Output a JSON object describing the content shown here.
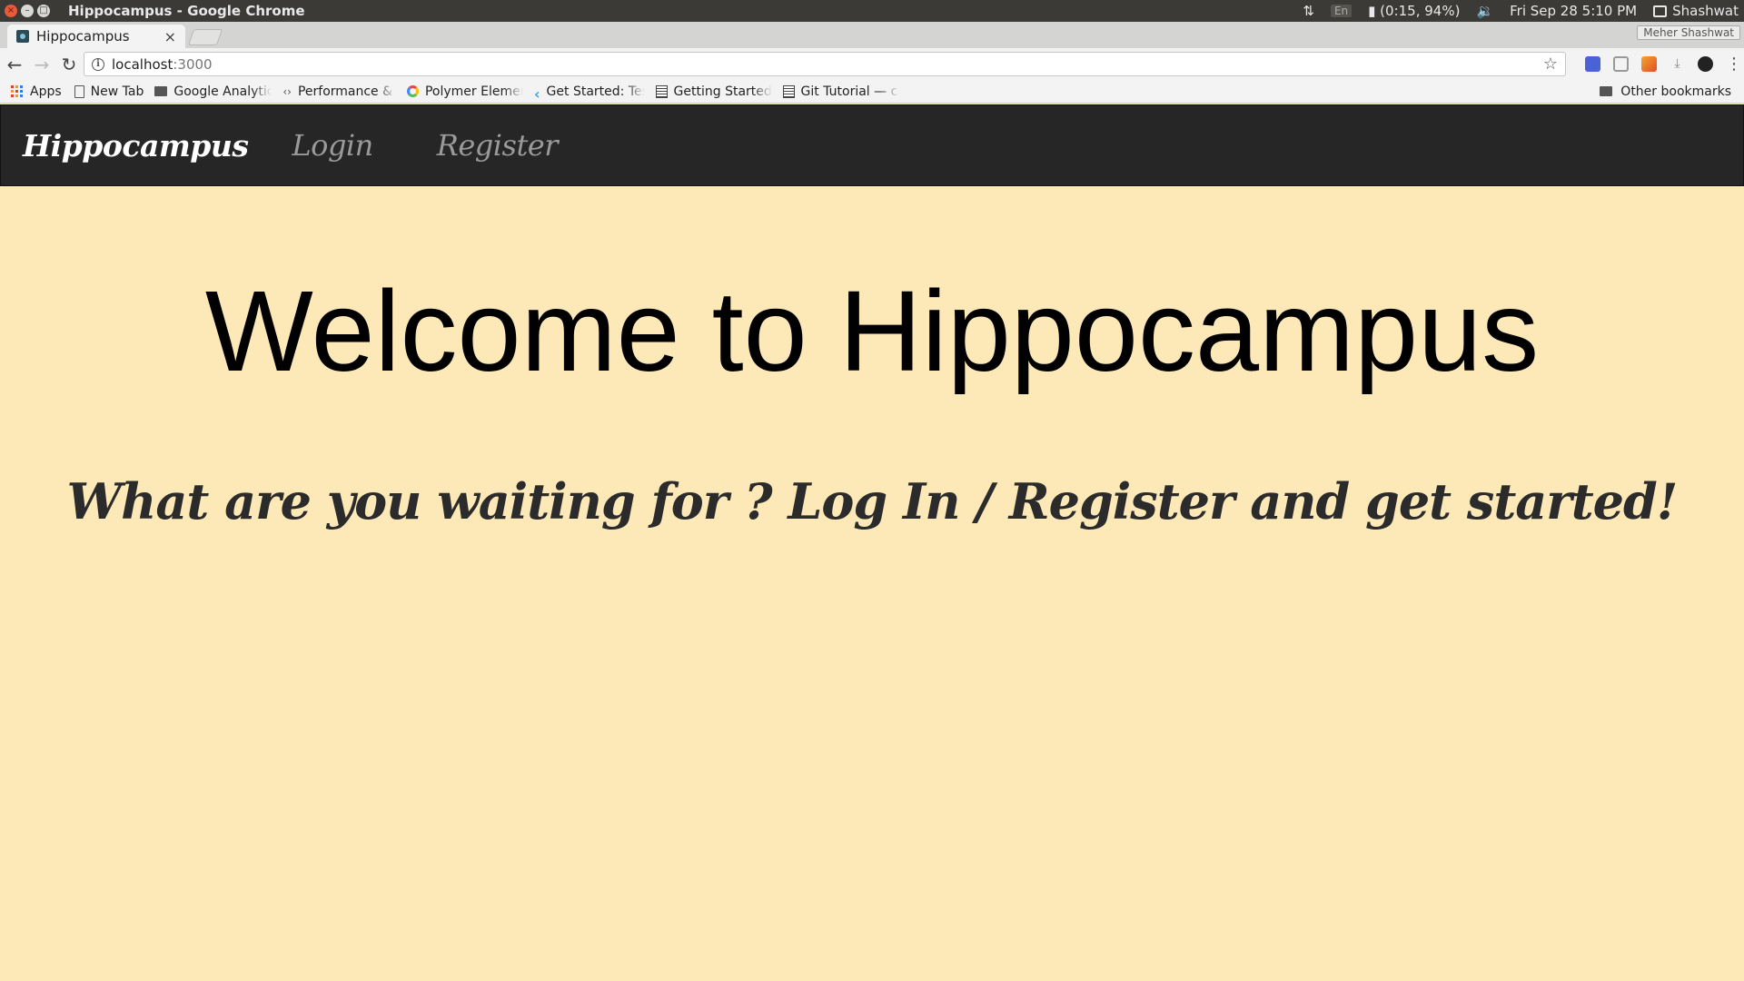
{
  "os": {
    "window_title": "Hippocampus - Google Chrome",
    "input_lang": "En",
    "battery": "(0:15, 94%)",
    "datetime": "Fri Sep 28  5:10 PM",
    "user": "Shashwat"
  },
  "browser": {
    "tab_title": "Hippocampus",
    "tab_close": "×",
    "profile": "Meher Shashwat",
    "url_host": "localhost",
    "url_port": ":3000",
    "bookmarks": [
      {
        "label": "Apps"
      },
      {
        "label": "New Tab"
      },
      {
        "label": "Google Analytic"
      },
      {
        "label": "Performance & "
      },
      {
        "label": "Polymer Elemen"
      },
      {
        "label": "Get Started: Tes"
      },
      {
        "label": "Getting Started"
      },
      {
        "label": "Git Tutorial — c"
      }
    ],
    "other_bookmarks": "Other bookmarks"
  },
  "site": {
    "brand": "Hippocampus",
    "nav": [
      {
        "label": "Login"
      },
      {
        "label": "Register"
      }
    ],
    "hero_title": "Welcome to Hippocampus",
    "hero_subtitle": "What are you waiting for ? Log In / Register and get started!"
  },
  "colors": {
    "page_bg": "#fde9b8",
    "navbar_bg": "#262626",
    "brand_text": "#ffffff",
    "nav_link_text": "#9a9a9a"
  }
}
